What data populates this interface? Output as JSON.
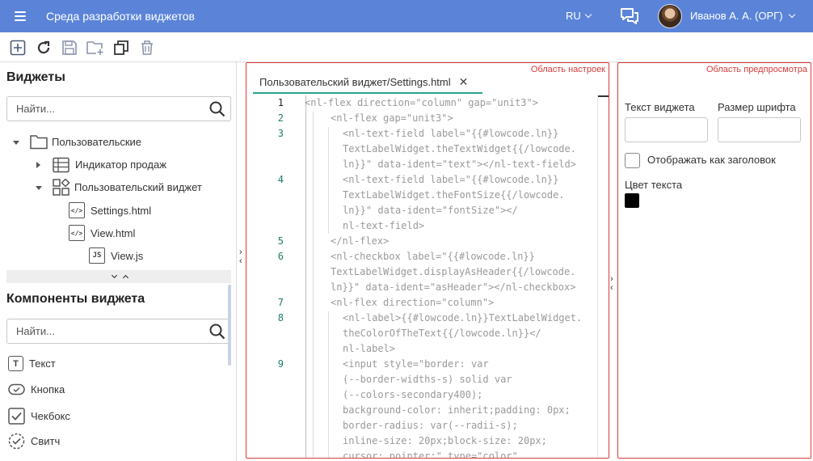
{
  "header": {
    "app_title": "Среда разработки виджетов",
    "language": "RU",
    "user_name": "Иванов А. А. (ОРГ)"
  },
  "toolbar": {
    "icons": [
      "add-icon",
      "refresh-icon",
      "save-icon",
      "add-folder-icon",
      "copy-icon",
      "delete-icon"
    ]
  },
  "widgets_panel": {
    "title": "Виджеты",
    "search_placeholder": "Найти...",
    "tree": [
      {
        "label": "Пользовательские",
        "icon": "folder-icon",
        "expanded": true
      },
      {
        "label": "Индикатор продаж",
        "icon": "widget-table-icon",
        "expanded": false
      },
      {
        "label": "Пользовательский виджет",
        "icon": "widget-shapes-icon",
        "expanded": true
      },
      {
        "label": "Settings.html",
        "icon": "html-file-icon"
      },
      {
        "label": "View.html",
        "icon": "html-file-icon"
      },
      {
        "label": "View.js",
        "icon": "js-file-icon",
        "badge": "JS"
      }
    ]
  },
  "components_panel": {
    "title": "Компоненты виджета",
    "search_placeholder": "Найти...",
    "items": [
      {
        "label": "Текст",
        "icon": "text-icon"
      },
      {
        "label": "Кнопка",
        "icon": "button-icon"
      },
      {
        "label": "Чекбокс",
        "icon": "checkbox-icon"
      },
      {
        "label": "Свитч",
        "icon": "switch-icon"
      }
    ]
  },
  "editor": {
    "region_label": "Область настроек",
    "tab_label": "Пользовательский виджет/Settings.html",
    "line_numbers": [
      "1",
      "2",
      "3",
      "4",
      "5",
      "6",
      "7",
      "8",
      "9"
    ],
    "lines": [
      "<nl-flex direction=\"column\" gap=\"unit3\">",
      "<nl-flex gap=\"unit3\">",
      "<nl-text-field label=\"{{#lowcode.ln}}",
      "TextLabelWidget.theTextWidget{{/lowcode.",
      "ln}}\" data-ident=\"text\"></nl-text-field>",
      "<nl-text-field label=\"{{#lowcode.ln}}",
      "TextLabelWidget.theFontSize{{/lowcode.",
      "ln}}\" data-ident=\"fontSize\"></",
      "nl-text-field>",
      "</nl-flex>",
      "<nl-checkbox label=\"{{#lowcode.ln}}",
      "TextLabelWidget.displayAsHeader{{/lowcode.",
      "ln}}\" data-ident=\"asHeader\"></nl-checkbox>",
      "<nl-flex direction=\"column\">",
      "<nl-label>{{#lowcode.ln}}TextLabelWidget.",
      "theColorOfTheText{{/lowcode.ln}}</",
      "nl-label>",
      "<input style=\"border: var",
      "(--border-widths-s) solid var",
      "(--colors-secondary400);",
      "background-color: inherit;padding: 0px;",
      "border-radius: var(--radii-s);",
      "inline-size: 20px;block-size: 20px;",
      "cursor: pointer;\" type=\"color\""
    ]
  },
  "preview": {
    "region_label": "Область предпросмотра",
    "text_label": "Текст виджета",
    "font_size_label": "Размер шрифта",
    "checkbox_label": "Отображать как заголовок",
    "color_label": "Цвет текста",
    "text_color": "#000000"
  },
  "colors": {
    "header_bg": "#5b84d8",
    "region_border": "#d93a3a",
    "tab_underline": "#2aa38a",
    "line_number": "#1f7d6a"
  }
}
